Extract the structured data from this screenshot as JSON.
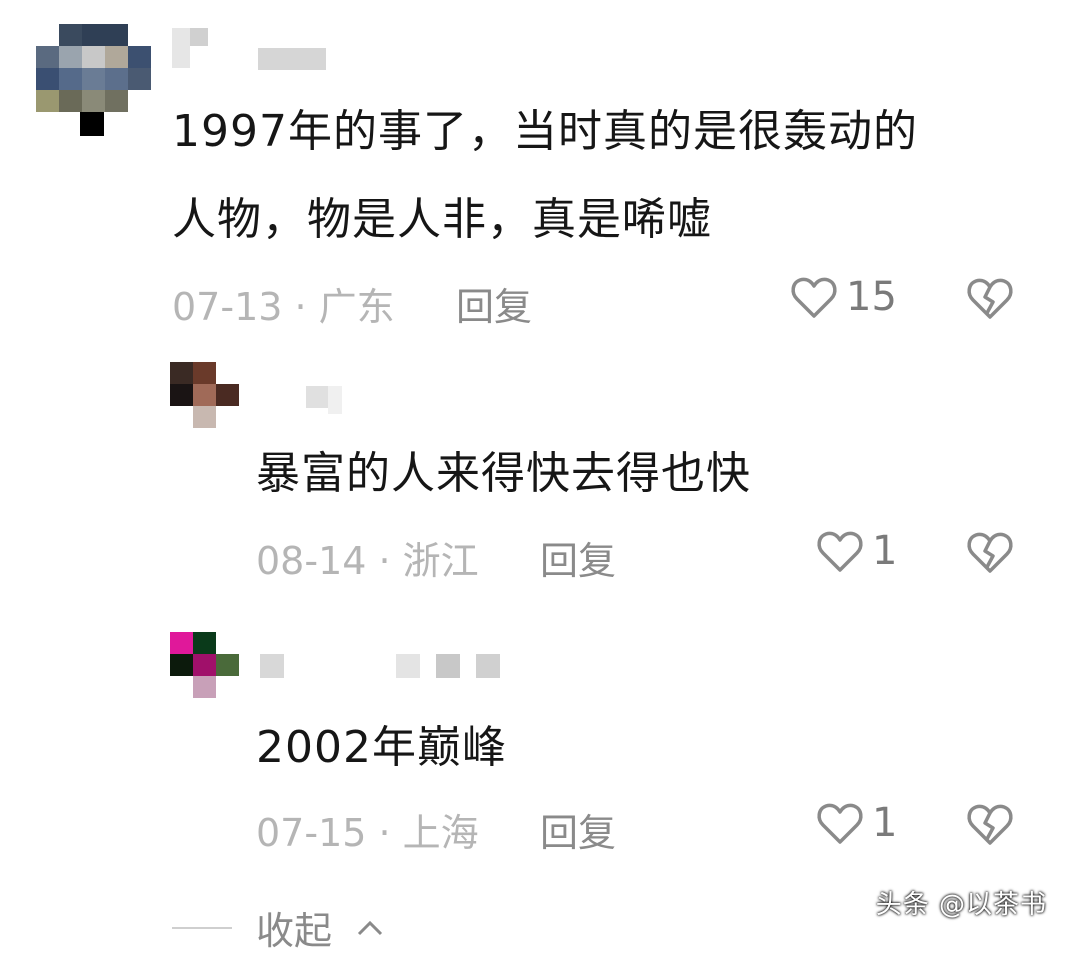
{
  "comments": [
    {
      "text_lines": [
        "1997年的事了，当时真的是很轰动的",
        "人物，物是人非，真是唏嘘"
      ],
      "date_location": "07-13 · 广东",
      "reply_label": "回复",
      "like_count": "15"
    },
    {
      "text_lines": [
        "暴富的人来得快去得也快"
      ],
      "date_location": "08-14 · 浙江",
      "reply_label": "回复",
      "like_count": "1"
    },
    {
      "text_lines": [
        "2002年巅峰"
      ],
      "date_location": "07-15 · 上海",
      "reply_label": "回复",
      "like_count": "1"
    }
  ],
  "collapse_label": "收起",
  "watermark": "头条 @以茶书",
  "icons": {
    "like": "heart-outline-icon",
    "dislike": "broken-heart-icon",
    "collapse": "chevron-up-icon"
  },
  "colors": {
    "text": "#161616",
    "meta": "#b5b5b5",
    "reply": "#8a8a8a",
    "icon": "#8a8a8a"
  }
}
